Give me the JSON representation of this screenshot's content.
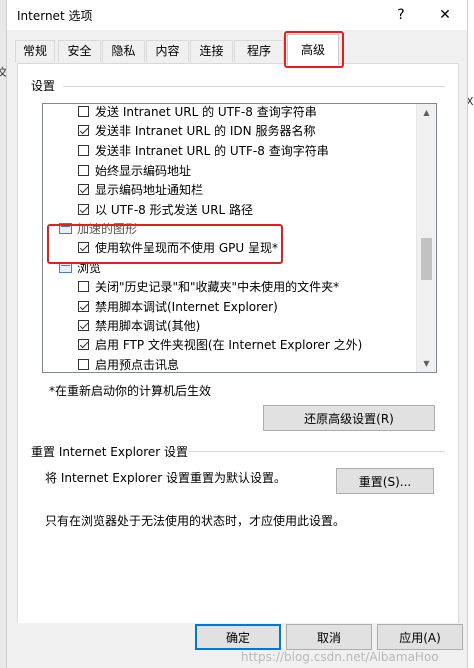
{
  "background_app": {
    "left_glyph": "文",
    "right_glyph": "X"
  },
  "dialog": {
    "title": "Internet 选项",
    "help_button": "?",
    "close_button": "✕"
  },
  "tabs": [
    {
      "label": "常规"
    },
    {
      "label": "安全"
    },
    {
      "label": "隐私"
    },
    {
      "label": "内容"
    },
    {
      "label": "连接"
    },
    {
      "label": "程序"
    },
    {
      "label": "高级",
      "active": true
    }
  ],
  "settings_group": {
    "label": "设置",
    "items": [
      {
        "type": "checkbox",
        "checked": false,
        "label": "发送 Intranet URL 的 UTF-8 查询字符串"
      },
      {
        "type": "checkbox",
        "checked": true,
        "label": "发送非 Intranet URL 的 IDN 服务器名称"
      },
      {
        "type": "checkbox",
        "checked": false,
        "label": "发送非 Intranet URL 的 UTF-8 查询字符串"
      },
      {
        "type": "checkbox",
        "checked": false,
        "label": "始终显示编码地址"
      },
      {
        "type": "checkbox",
        "checked": true,
        "label": "显示编码地址通知栏"
      },
      {
        "type": "checkbox",
        "checked": true,
        "label": "以 UTF-8 形式发送 URL 路径"
      },
      {
        "type": "category",
        "label": "加速的图形"
      },
      {
        "type": "checkbox",
        "checked": true,
        "label": "使用软件呈现而不使用 GPU 呈现*"
      },
      {
        "type": "category",
        "label": "浏览"
      },
      {
        "type": "checkbox",
        "checked": false,
        "label": "关闭\"历史记录\"和\"收藏夹\"中未使用的文件夹*"
      },
      {
        "type": "checkbox",
        "checked": true,
        "label": "禁用脚本调试(Internet Explorer)"
      },
      {
        "type": "checkbox",
        "checked": true,
        "label": "禁用脚本调试(其他)"
      },
      {
        "type": "checkbox",
        "checked": true,
        "label": "启用 FTP 文件夹视图(在 Internet Explorer 之外)"
      },
      {
        "type": "checkbox",
        "checked": false,
        "label": "启用预点击讯息"
      }
    ],
    "restart_note": "*在重新启动你的计算机后生效",
    "restore_button": "还原高级设置(R)"
  },
  "reset_group": {
    "label": "重置 Internet Explorer 设置",
    "description": "将 Internet Explorer 设置重置为默认设置。",
    "reset_button": "重置(S)...",
    "warning": "只有在浏览器处于无法使用的状态时，才应使用此设置。"
  },
  "footer": {
    "ok": "确定",
    "cancel": "取消",
    "apply": "应用(A)",
    "watermark": "https://blog.csdn.net/AlbamaHoo"
  },
  "colors": {
    "highlight_box": "#e0211f",
    "default_button_border": "#0078d7"
  }
}
